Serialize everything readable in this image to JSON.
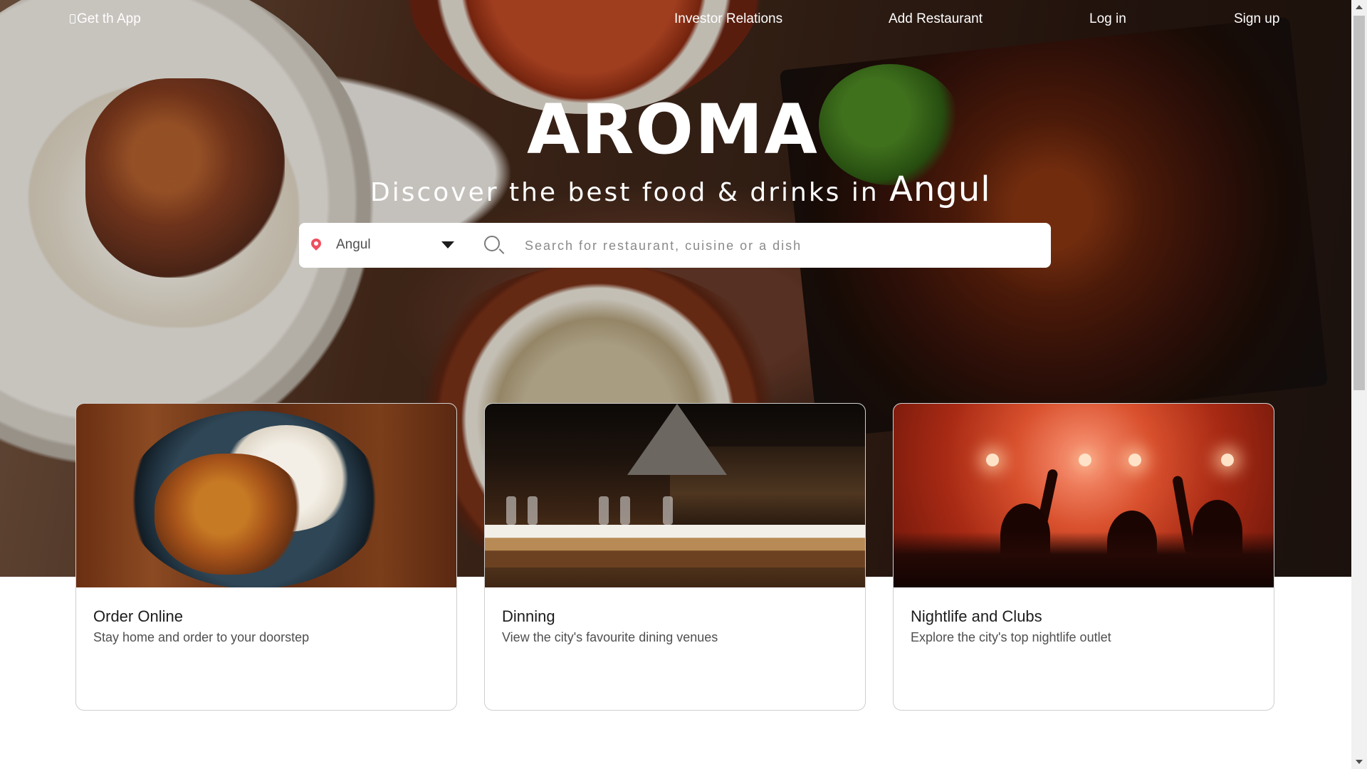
{
  "nav": {
    "get_app": "Get th App",
    "investor_relations": "Investor Relations",
    "add_restaurant": "Add Restaurant",
    "log_in": "Log in",
    "sign_up": "Sign up"
  },
  "hero": {
    "brand": "AROMA",
    "tagline_prefix": "Discover the best food & drinks in ",
    "tagline_city": "Angul"
  },
  "search": {
    "location_value": "Angul",
    "placeholder": "Search for restaurant, cuisine or a dish",
    "location_icon": "location-pin-icon",
    "search_icon": "search-icon",
    "dropdown_icon": "caret-down-icon"
  },
  "cards": [
    {
      "title": "Order Online",
      "description": "Stay home and order to your doorstep"
    },
    {
      "title": "Dinning",
      "description": "View the city's favourite dining venues"
    },
    {
      "title": "Nightlife and Clubs",
      "description": "Explore the city's top nightlife outlet"
    }
  ],
  "colors": {
    "accent": "#ef4f5f",
    "text_dark": "#1c1c1c",
    "text_muted": "#4f4f4f"
  }
}
